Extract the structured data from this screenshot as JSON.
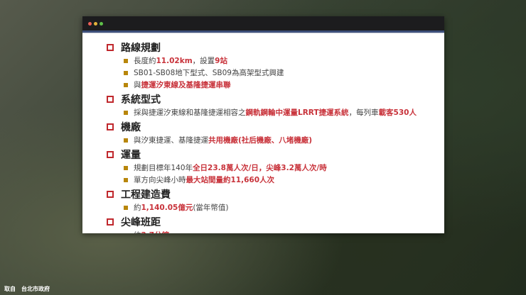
{
  "window": {
    "colors": {
      "close": "#ec5f57",
      "minimize": "#e3b33b",
      "maximize": "#5fc14a",
      "accent": "#c8323a"
    }
  },
  "sections": [
    {
      "title": "路線規劃",
      "items": [
        [
          {
            "t": "長度約",
            "h": false
          },
          {
            "t": "11.02km",
            "h": true
          },
          {
            "t": "，設置",
            "h": false
          },
          {
            "t": "9站",
            "h": true
          }
        ],
        [
          {
            "t": "SB01-SB08地下型式、SB09為高架型式興建",
            "h": false
          }
        ],
        [
          {
            "t": "與",
            "h": false
          },
          {
            "t": "捷運汐東線及基隆捷運串聯",
            "h": true
          }
        ]
      ]
    },
    {
      "title": "系統型式",
      "items": [
        [
          {
            "t": "採與捷運汐東線和基隆捷運相容之",
            "h": false
          },
          {
            "t": "鋼軌鋼輪中運量LRRT捷運系統",
            "h": true
          },
          {
            "t": "，每列車",
            "h": false
          },
          {
            "t": "載客530人",
            "h": true
          }
        ]
      ]
    },
    {
      "title": "機廠",
      "items": [
        [
          {
            "t": "與汐東捷運、基隆捷運",
            "h": false
          },
          {
            "t": "共用機廠(社后機廠、八堵機廠)",
            "h": true
          }
        ]
      ]
    },
    {
      "title": "運量",
      "items": [
        [
          {
            "t": "規劃目標年140年",
            "h": false
          },
          {
            "t": "全日23.8萬人次/日，尖峰3.2萬人次/時",
            "h": true
          }
        ],
        [
          {
            "t": "單方向尖峰小時",
            "h": false
          },
          {
            "t": "最大站間量約11,660人次",
            "h": true
          }
        ]
      ]
    },
    {
      "title": "工程建造費",
      "items": [
        [
          {
            "t": "約",
            "h": false
          },
          {
            "t": "1,140.05億元",
            "h": true
          },
          {
            "t": "(當年幣值)",
            "h": false
          }
        ]
      ]
    },
    {
      "title": "尖峰班距",
      "items": [
        [
          {
            "t": "約",
            "h": false
          },
          {
            "t": "2.7分鐘",
            "h": true
          }
        ]
      ]
    },
    {
      "title": "轉乘車站",
      "items": []
    }
  ],
  "credit": "取自　台北市政府"
}
